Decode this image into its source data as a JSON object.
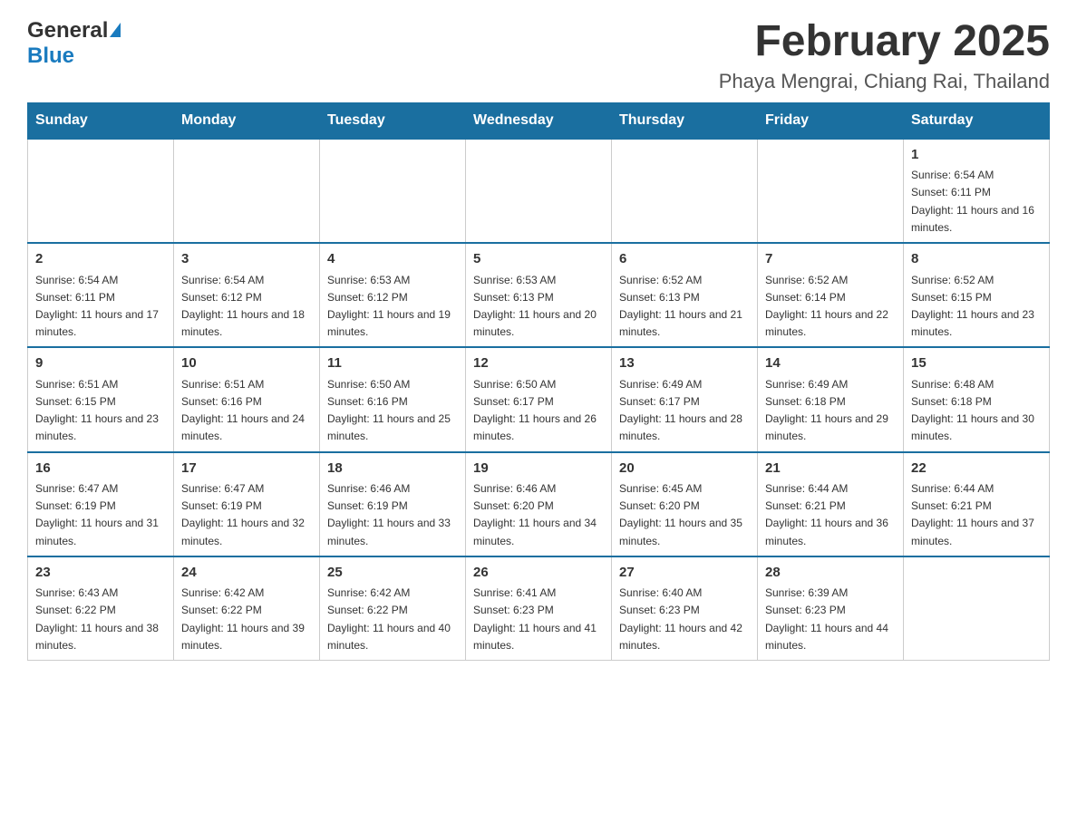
{
  "header": {
    "logo_general": "General",
    "logo_blue": "Blue",
    "month_title": "February 2025",
    "location": "Phaya Mengrai, Chiang Rai, Thailand"
  },
  "days_of_week": [
    "Sunday",
    "Monday",
    "Tuesday",
    "Wednesday",
    "Thursday",
    "Friday",
    "Saturday"
  ],
  "weeks": [
    [
      {
        "day": "",
        "info": ""
      },
      {
        "day": "",
        "info": ""
      },
      {
        "day": "",
        "info": ""
      },
      {
        "day": "",
        "info": ""
      },
      {
        "day": "",
        "info": ""
      },
      {
        "day": "",
        "info": ""
      },
      {
        "day": "1",
        "info": "Sunrise: 6:54 AM\nSunset: 6:11 PM\nDaylight: 11 hours and 16 minutes."
      }
    ],
    [
      {
        "day": "2",
        "info": "Sunrise: 6:54 AM\nSunset: 6:11 PM\nDaylight: 11 hours and 17 minutes."
      },
      {
        "day": "3",
        "info": "Sunrise: 6:54 AM\nSunset: 6:12 PM\nDaylight: 11 hours and 18 minutes."
      },
      {
        "day": "4",
        "info": "Sunrise: 6:53 AM\nSunset: 6:12 PM\nDaylight: 11 hours and 19 minutes."
      },
      {
        "day": "5",
        "info": "Sunrise: 6:53 AM\nSunset: 6:13 PM\nDaylight: 11 hours and 20 minutes."
      },
      {
        "day": "6",
        "info": "Sunrise: 6:52 AM\nSunset: 6:13 PM\nDaylight: 11 hours and 21 minutes."
      },
      {
        "day": "7",
        "info": "Sunrise: 6:52 AM\nSunset: 6:14 PM\nDaylight: 11 hours and 22 minutes."
      },
      {
        "day": "8",
        "info": "Sunrise: 6:52 AM\nSunset: 6:15 PM\nDaylight: 11 hours and 23 minutes."
      }
    ],
    [
      {
        "day": "9",
        "info": "Sunrise: 6:51 AM\nSunset: 6:15 PM\nDaylight: 11 hours and 23 minutes."
      },
      {
        "day": "10",
        "info": "Sunrise: 6:51 AM\nSunset: 6:16 PM\nDaylight: 11 hours and 24 minutes."
      },
      {
        "day": "11",
        "info": "Sunrise: 6:50 AM\nSunset: 6:16 PM\nDaylight: 11 hours and 25 minutes."
      },
      {
        "day": "12",
        "info": "Sunrise: 6:50 AM\nSunset: 6:17 PM\nDaylight: 11 hours and 26 minutes."
      },
      {
        "day": "13",
        "info": "Sunrise: 6:49 AM\nSunset: 6:17 PM\nDaylight: 11 hours and 28 minutes."
      },
      {
        "day": "14",
        "info": "Sunrise: 6:49 AM\nSunset: 6:18 PM\nDaylight: 11 hours and 29 minutes."
      },
      {
        "day": "15",
        "info": "Sunrise: 6:48 AM\nSunset: 6:18 PM\nDaylight: 11 hours and 30 minutes."
      }
    ],
    [
      {
        "day": "16",
        "info": "Sunrise: 6:47 AM\nSunset: 6:19 PM\nDaylight: 11 hours and 31 minutes."
      },
      {
        "day": "17",
        "info": "Sunrise: 6:47 AM\nSunset: 6:19 PM\nDaylight: 11 hours and 32 minutes."
      },
      {
        "day": "18",
        "info": "Sunrise: 6:46 AM\nSunset: 6:19 PM\nDaylight: 11 hours and 33 minutes."
      },
      {
        "day": "19",
        "info": "Sunrise: 6:46 AM\nSunset: 6:20 PM\nDaylight: 11 hours and 34 minutes."
      },
      {
        "day": "20",
        "info": "Sunrise: 6:45 AM\nSunset: 6:20 PM\nDaylight: 11 hours and 35 minutes."
      },
      {
        "day": "21",
        "info": "Sunrise: 6:44 AM\nSunset: 6:21 PM\nDaylight: 11 hours and 36 minutes."
      },
      {
        "day": "22",
        "info": "Sunrise: 6:44 AM\nSunset: 6:21 PM\nDaylight: 11 hours and 37 minutes."
      }
    ],
    [
      {
        "day": "23",
        "info": "Sunrise: 6:43 AM\nSunset: 6:22 PM\nDaylight: 11 hours and 38 minutes."
      },
      {
        "day": "24",
        "info": "Sunrise: 6:42 AM\nSunset: 6:22 PM\nDaylight: 11 hours and 39 minutes."
      },
      {
        "day": "25",
        "info": "Sunrise: 6:42 AM\nSunset: 6:22 PM\nDaylight: 11 hours and 40 minutes."
      },
      {
        "day": "26",
        "info": "Sunrise: 6:41 AM\nSunset: 6:23 PM\nDaylight: 11 hours and 41 minutes."
      },
      {
        "day": "27",
        "info": "Sunrise: 6:40 AM\nSunset: 6:23 PM\nDaylight: 11 hours and 42 minutes."
      },
      {
        "day": "28",
        "info": "Sunrise: 6:39 AM\nSunset: 6:23 PM\nDaylight: 11 hours and 44 minutes."
      },
      {
        "day": "",
        "info": ""
      }
    ]
  ]
}
